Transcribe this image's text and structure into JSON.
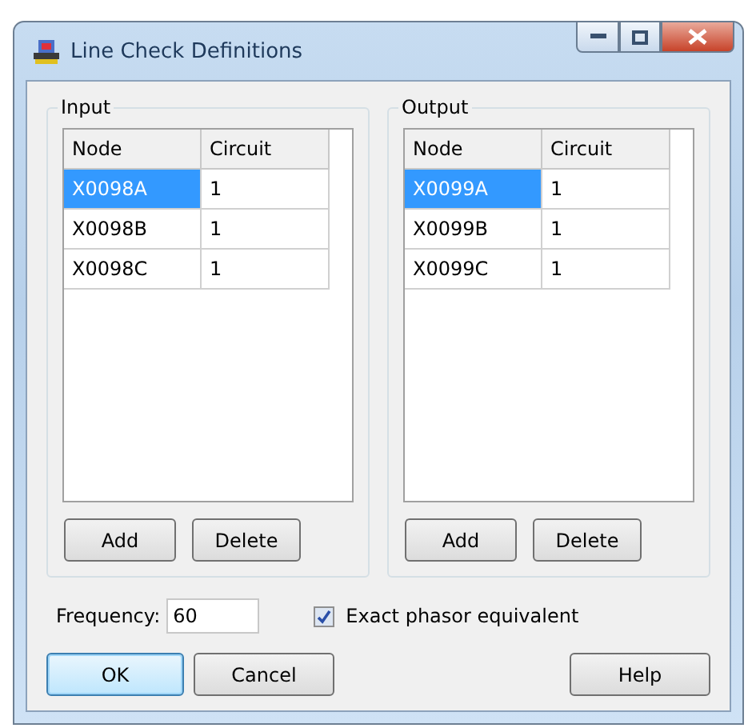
{
  "window": {
    "title": "Line Check Definitions"
  },
  "groups": [
    {
      "label": "Input",
      "columns": [
        "Node",
        "Circuit"
      ],
      "rows": [
        {
          "node": "X0098A",
          "circuit": "1",
          "selected": true
        },
        {
          "node": "X0098B",
          "circuit": "1",
          "selected": false
        },
        {
          "node": "X0098C",
          "circuit": "1",
          "selected": false
        }
      ],
      "buttons": [
        "Add",
        "Delete"
      ]
    },
    {
      "label": "Output",
      "columns": [
        "Node",
        "Circuit"
      ],
      "rows": [
        {
          "node": "X0099A",
          "circuit": "1",
          "selected": true
        },
        {
          "node": "X0099B",
          "circuit": "1",
          "selected": false
        },
        {
          "node": "X0099C",
          "circuit": "1",
          "selected": false
        }
      ],
      "buttons": [
        "Add",
        "Delete"
      ]
    }
  ],
  "frequency": {
    "label": "Frequency:",
    "value": "60"
  },
  "exact_phasor": {
    "label": "Exact phasor equivalent",
    "checked": true
  },
  "buttons": [
    {
      "label": "OK",
      "default": true
    },
    {
      "label": "Cancel",
      "default": false
    },
    {
      "label": "Help",
      "default": false
    }
  ]
}
